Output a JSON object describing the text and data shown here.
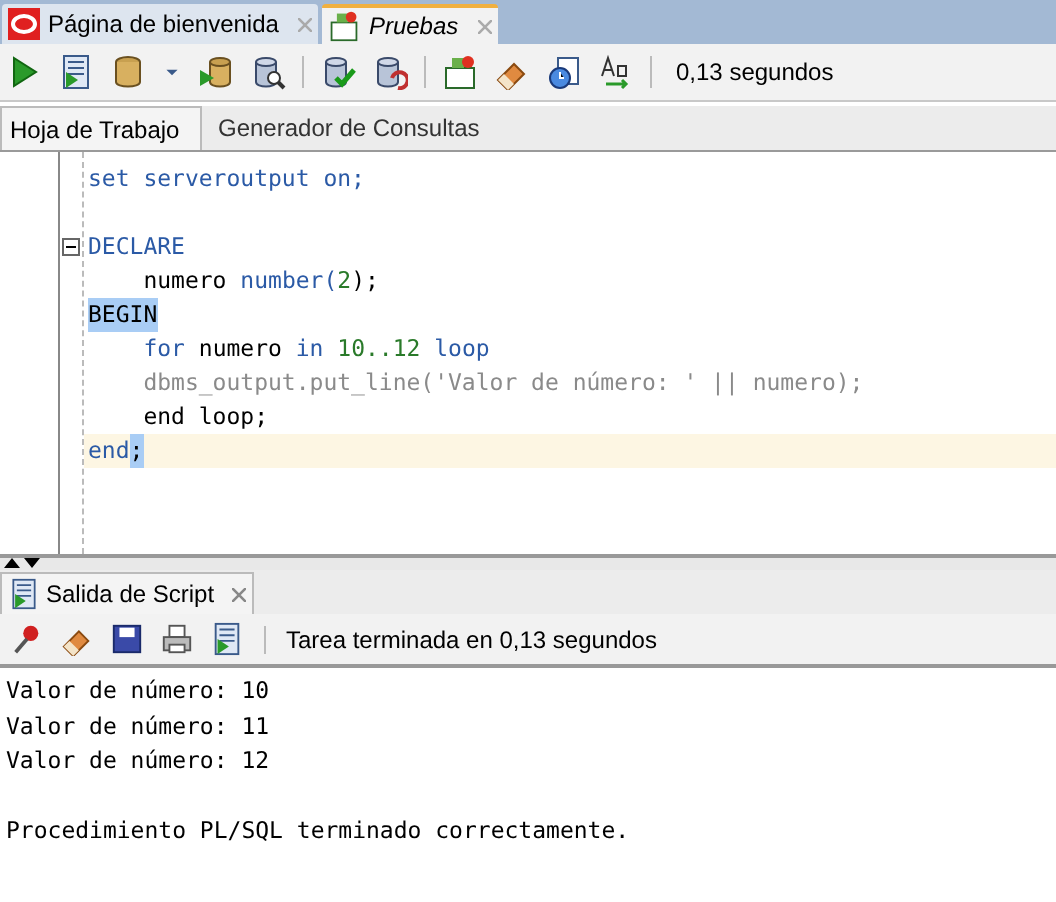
{
  "doc_tabs": [
    {
      "label": "Página de bienvenida",
      "kind": "welcome",
      "selected": false,
      "italic": false
    },
    {
      "label": "Pruebas",
      "kind": "sql",
      "selected": true,
      "italic": true
    }
  ],
  "toolbar": {
    "time": "0,13 segundos"
  },
  "editor_tabs": [
    {
      "label": "Hoja de Trabajo",
      "selected": true
    },
    {
      "label": "Generador de Consultas",
      "selected": false
    }
  ],
  "code": [
    {
      "fold": false,
      "current": false,
      "tokens": [
        {
          "t": "set serveroutput on;",
          "kind": "keyword",
          "hl": false
        }
      ]
    },
    {
      "fold": false,
      "current": false
    },
    {
      "fold": true,
      "current": false,
      "tokens": [
        {
          "t": "DECLARE",
          "kind": "keyword",
          "hl": false
        }
      ]
    },
    {
      "fold": false,
      "current": false,
      "tokens": [
        {
          "t": "    numero ",
          "kind": "plain",
          "hl": false
        },
        {
          "t": "number(",
          "kind": "keyword",
          "hl": false
        },
        {
          "t": "2",
          "kind": "number",
          "hl": false
        },
        {
          "t": ");",
          "kind": "plain",
          "hl": false
        }
      ]
    },
    {
      "fold": false,
      "current": false,
      "tokens": [
        {
          "t": "BEGIN",
          "kind": "plain",
          "hl": true
        }
      ]
    },
    {
      "fold": false,
      "current": false,
      "tokens": [
        {
          "t": "    for ",
          "kind": "keyword",
          "hl": false
        },
        {
          "t": "numero ",
          "kind": "plain",
          "hl": false
        },
        {
          "t": "in ",
          "kind": "keyword",
          "hl": false
        },
        {
          "t": "10..12",
          "kind": "number",
          "hl": false
        },
        {
          "t": " loop",
          "kind": "keyword",
          "hl": false
        }
      ]
    },
    {
      "fold": false,
      "current": false,
      "tokens": [
        {
          "t": "    dbms_output.put_line('Valor de número: ' || numero);",
          "kind": "muted",
          "hl": false
        }
      ]
    },
    {
      "fold": false,
      "current": false,
      "tokens": [
        {
          "t": "    end loop;",
          "kind": "plain",
          "hl": false
        }
      ]
    },
    {
      "fold": false,
      "current": true,
      "tokens": [
        {
          "t": "end",
          "kind": "keyword",
          "hl": false
        },
        {
          "t": ";",
          "kind": "plain",
          "hl": true
        }
      ]
    }
  ],
  "output_tab": {
    "label": "Salida de Script"
  },
  "output_toolbar": {
    "status": "Tarea terminada en 0,13 segundos"
  },
  "output_paragraphs": [
    [
      "Valor de número: 10",
      "Valor de número: 11",
      "Valor de número: 12"
    ],
    [
      "Procedimiento PL/SQL terminado correctamente."
    ]
  ]
}
